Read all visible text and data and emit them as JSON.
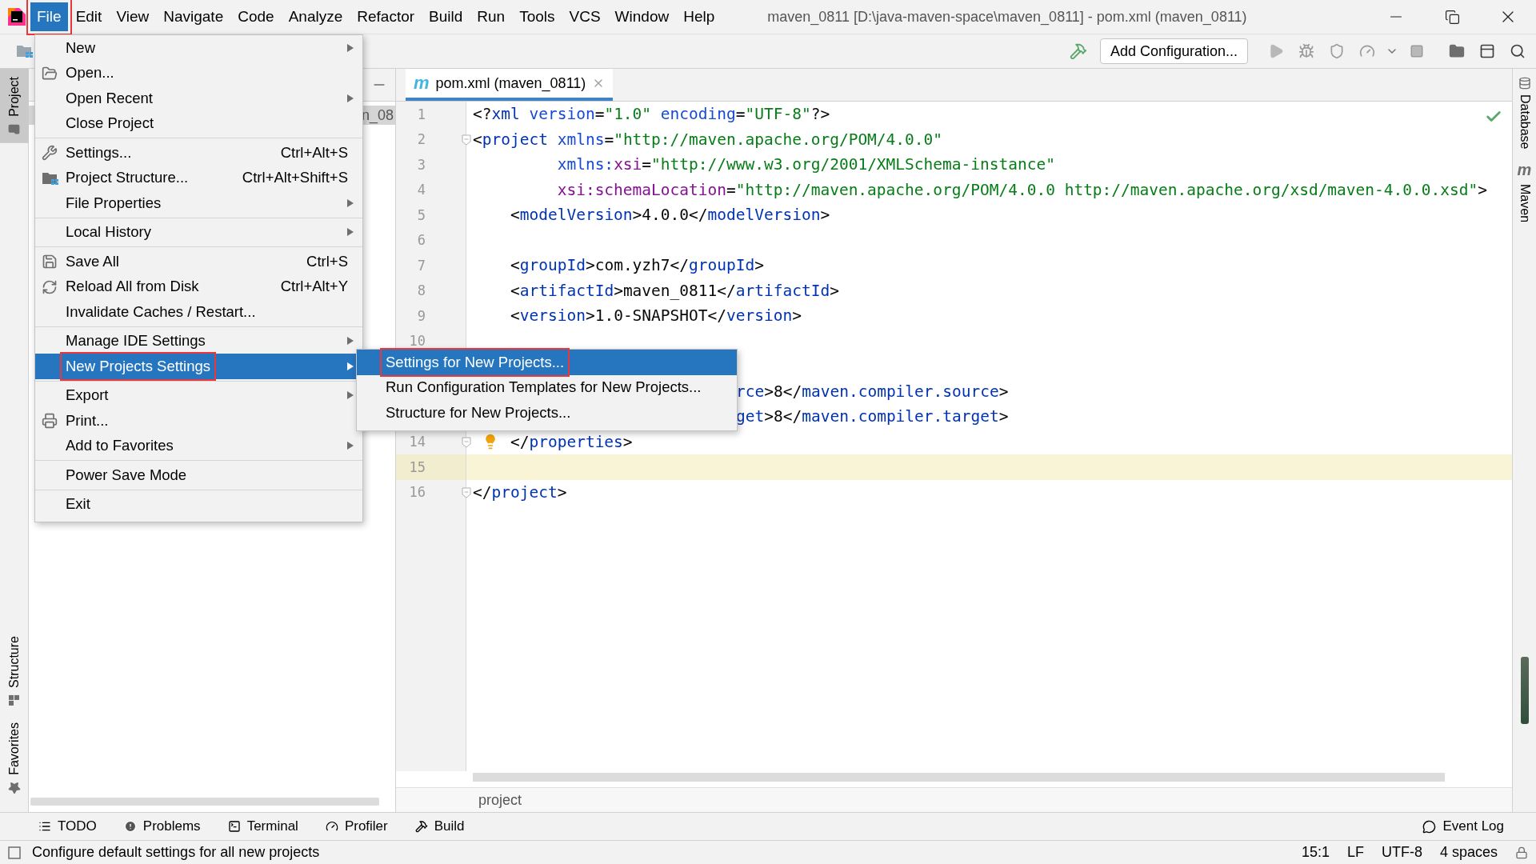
{
  "window": {
    "title": "maven_0811 [D:\\java-maven-space\\maven_0811] - pom.xml (maven_0811)"
  },
  "menu_bar": [
    {
      "label": "File",
      "selected": true,
      "marked": true
    },
    {
      "label": "Edit",
      "selected": false,
      "marked": false
    },
    {
      "label": "View",
      "selected": false,
      "marked": false
    },
    {
      "label": "Navigate",
      "selected": false,
      "marked": false
    },
    {
      "label": "Code",
      "selected": false,
      "marked": false
    },
    {
      "label": "Analyze",
      "selected": false,
      "marked": false
    },
    {
      "label": "Refactor",
      "selected": false,
      "marked": false
    },
    {
      "label": "Build",
      "selected": false,
      "marked": false
    },
    {
      "label": "Run",
      "selected": false,
      "marked": false
    },
    {
      "label": "Tools",
      "selected": false,
      "marked": false
    },
    {
      "label": "VCS",
      "selected": false,
      "marked": false
    },
    {
      "label": "Window",
      "selected": false,
      "marked": false
    },
    {
      "label": "Help",
      "selected": false,
      "marked": false
    }
  ],
  "toolbar": {
    "run_configuration": "Add Configuration..."
  },
  "left_tool_strip": [
    {
      "label": "Project",
      "selected": true
    },
    {
      "label": "Structure",
      "selected": false
    },
    {
      "label": "Favorites",
      "selected": false
    }
  ],
  "project_panel": {
    "tree_rows": [
      {
        "label": "n_08",
        "selected": true
      }
    ]
  },
  "editor": {
    "tabs": [
      {
        "icon": "m",
        "label": "pom.xml (maven_0811)",
        "selected": true
      }
    ],
    "lines": [
      {
        "kind": "full",
        "number": "1",
        "current": false,
        "fold": false,
        "bulb": false,
        "segments": [
          {
            "kind": "punct",
            "text": "<?"
          },
          {
            "kind": "tag",
            "text": "xml"
          },
          {
            "kind": "attr",
            "text": " version"
          },
          {
            "kind": "punct",
            "text": "="
          },
          {
            "kind": "value",
            "text": "\"1.0\""
          },
          {
            "kind": "attr",
            "text": " encoding"
          },
          {
            "kind": "punct",
            "text": "="
          },
          {
            "kind": "value",
            "text": "\"UTF-8\""
          },
          {
            "kind": "punct",
            "text": "?>"
          }
        ]
      },
      {
        "kind": "full",
        "number": "2",
        "current": false,
        "fold": true,
        "bulb": false,
        "segments": [
          {
            "kind": "punct",
            "text": "<"
          },
          {
            "kind": "tag",
            "text": "project"
          },
          {
            "kind": "attr",
            "text": " xmlns"
          },
          {
            "kind": "punct",
            "text": "="
          },
          {
            "kind": "value",
            "text": "\"http://maven.apache.org/POM/4.0.0\""
          }
        ]
      },
      {
        "kind": "full",
        "number": "3",
        "current": false,
        "fold": false,
        "bulb": false,
        "segments": [
          {
            "kind": "attr",
            "text": "         xmlns:"
          },
          {
            "kind": "ns",
            "text": "xsi"
          },
          {
            "kind": "punct",
            "text": "="
          },
          {
            "kind": "value",
            "text": "\"http://www.w3.org/2001/XMLSchema-instance\""
          }
        ]
      },
      {
        "kind": "full",
        "number": "4",
        "current": false,
        "fold": false,
        "bulb": false,
        "segments": [
          {
            "kind": "ns",
            "text": "         xsi:schemaLocation"
          },
          {
            "kind": "punct",
            "text": "="
          },
          {
            "kind": "value",
            "text": "\"http://maven.apache.org/POM/4.0.0 http://maven.apache.org/xsd/maven-4.0.0.xsd\""
          },
          {
            "kind": "punct",
            "text": ">"
          }
        ]
      },
      {
        "kind": "full",
        "number": "5",
        "current": false,
        "fold": false,
        "bulb": false,
        "segments": [
          {
            "kind": "punct",
            "text": "    <"
          },
          {
            "kind": "tag",
            "text": "modelVersion"
          },
          {
            "kind": "punct",
            "text": ">"
          },
          {
            "kind": "text",
            "text": "4.0.0"
          },
          {
            "kind": "punct",
            "text": "</"
          },
          {
            "kind": "tag",
            "text": "modelVersion"
          },
          {
            "kind": "punct",
            "text": ">"
          }
        ]
      },
      {
        "kind": "full",
        "number": "6",
        "current": false,
        "fold": false,
        "bulb": false
      },
      {
        "kind": "full",
        "number": "7",
        "current": false,
        "fold": false,
        "bulb": false,
        "segments": [
          {
            "kind": "punct",
            "text": "    <"
          },
          {
            "kind": "tag",
            "text": "groupId"
          },
          {
            "kind": "punct",
            "text": ">"
          },
          {
            "kind": "text",
            "text": "com.yzh7"
          },
          {
            "kind": "punct",
            "text": "</"
          },
          {
            "kind": "tag",
            "text": "groupId"
          },
          {
            "kind": "punct",
            "text": ">"
          }
        ]
      },
      {
        "kind": "full",
        "number": "8",
        "current": false,
        "fold": false,
        "bulb": false,
        "segments": [
          {
            "kind": "punct",
            "text": "    <"
          },
          {
            "kind": "tag",
            "text": "artifactId"
          },
          {
            "kind": "punct",
            "text": ">"
          },
          {
            "kind": "text",
            "text": "maven_0811"
          },
          {
            "kind": "punct",
            "text": "</"
          },
          {
            "kind": "tag",
            "text": "artifactId"
          },
          {
            "kind": "punct",
            "text": ">"
          }
        ]
      },
      {
        "kind": "full",
        "number": "9",
        "current": false,
        "fold": false,
        "bulb": false,
        "segments": [
          {
            "kind": "punct",
            "text": "    <"
          },
          {
            "kind": "tag",
            "text": "version"
          },
          {
            "kind": "punct",
            "text": ">"
          },
          {
            "kind": "text",
            "text": "1.0-SNAPSHOT"
          },
          {
            "kind": "punct",
            "text": "</"
          },
          {
            "kind": "tag",
            "text": "version"
          },
          {
            "kind": "punct",
            "text": ">"
          }
        ]
      },
      {
        "kind": "full",
        "number": "10",
        "current": false,
        "fold": false,
        "bulb": false
      },
      {
        "kind": "covered",
        "current": false
      },
      {
        "kind": "clipped",
        "current": false,
        "segments": [
          {
            "kind": "tag",
            "text": "rce"
          },
          {
            "kind": "punct",
            "text": ">"
          },
          {
            "kind": "text",
            "text": "8"
          },
          {
            "kind": "punct",
            "text": "</"
          },
          {
            "kind": "tag",
            "text": "maven.compiler.source"
          },
          {
            "kind": "punct",
            "text": ">"
          }
        ]
      },
      {
        "kind": "clipped",
        "current": false,
        "segments": [
          {
            "kind": "tag",
            "text": "get"
          },
          {
            "kind": "punct",
            "text": ">"
          },
          {
            "kind": "text",
            "text": "8"
          },
          {
            "kind": "punct",
            "text": "</"
          },
          {
            "kind": "tag",
            "text": "maven.compiler.target"
          },
          {
            "kind": "punct",
            "text": ">"
          }
        ]
      },
      {
        "kind": "full",
        "number": "14",
        "current": false,
        "fold": true,
        "bulb": true,
        "segments": [
          {
            "kind": "punct",
            "text": "    </"
          },
          {
            "kind": "tag",
            "text": "properties"
          },
          {
            "kind": "punct",
            "text": ">"
          }
        ]
      },
      {
        "kind": "full",
        "number": "15",
        "current": true,
        "fold": false,
        "bulb": false
      },
      {
        "kind": "full",
        "number": "16",
        "current": false,
        "fold": true,
        "bulb": false,
        "segments": [
          {
            "kind": "punct",
            "text": "</"
          },
          {
            "kind": "tag",
            "text": "project"
          },
          {
            "kind": "punct",
            "text": ">"
          }
        ]
      }
    ],
    "breadcrumb": "project"
  },
  "right_tool_strip": [
    {
      "label": "Database"
    },
    {
      "icon": "m",
      "label": "Maven"
    }
  ],
  "file_menu": {
    "groups": [
      [
        {
          "label": "New",
          "submenu": true,
          "selected": false,
          "marked": false
        },
        {
          "label": "Open...",
          "submenu": false,
          "selected": false,
          "marked": false
        },
        {
          "label": "Open Recent",
          "submenu": true,
          "selected": false,
          "marked": false
        },
        {
          "label": "Close Project",
          "submenu": false,
          "selected": false,
          "marked": false
        }
      ],
      [
        {
          "label": "Settings...",
          "shortcut": "Ctrl+Alt+S",
          "submenu": false,
          "selected": false,
          "marked": false
        },
        {
          "label": "Project Structure...",
          "shortcut": "Ctrl+Alt+Shift+S",
          "submenu": false,
          "selected": false,
          "marked": false
        },
        {
          "label": "File Properties",
          "submenu": true,
          "selected": false,
          "marked": false
        }
      ],
      [
        {
          "label": "Local History",
          "submenu": true,
          "selected": false,
          "marked": false
        }
      ],
      [
        {
          "label": "Save All",
          "shortcut": "Ctrl+S",
          "submenu": false,
          "selected": false,
          "marked": false
        },
        {
          "label": "Reload All from Disk",
          "shortcut": "Ctrl+Alt+Y",
          "submenu": false,
          "selected": false,
          "marked": false
        },
        {
          "label": "Invalidate Caches / Restart...",
          "submenu": false,
          "selected": false,
          "marked": false
        }
      ],
      [
        {
          "label": "Manage IDE Settings",
          "submenu": true,
          "selected": false,
          "marked": false
        },
        {
          "label": "New Projects Settings",
          "submenu": true,
          "selected": true,
          "marked": true
        }
      ],
      [
        {
          "label": "Export",
          "submenu": true,
          "selected": false,
          "marked": false
        },
        {
          "label": "Print...",
          "submenu": false,
          "selected": false,
          "marked": false
        },
        {
          "label": "Add to Favorites",
          "submenu": true,
          "selected": false,
          "marked": false
        }
      ],
      [
        {
          "label": "Power Save Mode",
          "submenu": false,
          "selected": false,
          "marked": false
        }
      ],
      [
        {
          "label": "Exit",
          "submenu": false,
          "selected": false,
          "marked": false
        }
      ]
    ]
  },
  "submenu": {
    "items": [
      {
        "label": "Settings for New Projects...",
        "selected": true,
        "marked": true
      },
      {
        "label": "Run Configuration Templates for New Projects...",
        "selected": false,
        "marked": false
      },
      {
        "label": "Structure for New Projects...",
        "selected": false,
        "marked": false
      }
    ]
  },
  "tool_window_bar": {
    "left": [
      "TODO",
      "Problems",
      "Terminal",
      "Profiler",
      "Build"
    ],
    "right": [
      "Event Log"
    ]
  },
  "status_bar": {
    "message": "Configure default settings for all new projects",
    "position": "15:1",
    "line_separator": "LF",
    "encoding": "UTF-8",
    "indent": "4 spaces"
  }
}
